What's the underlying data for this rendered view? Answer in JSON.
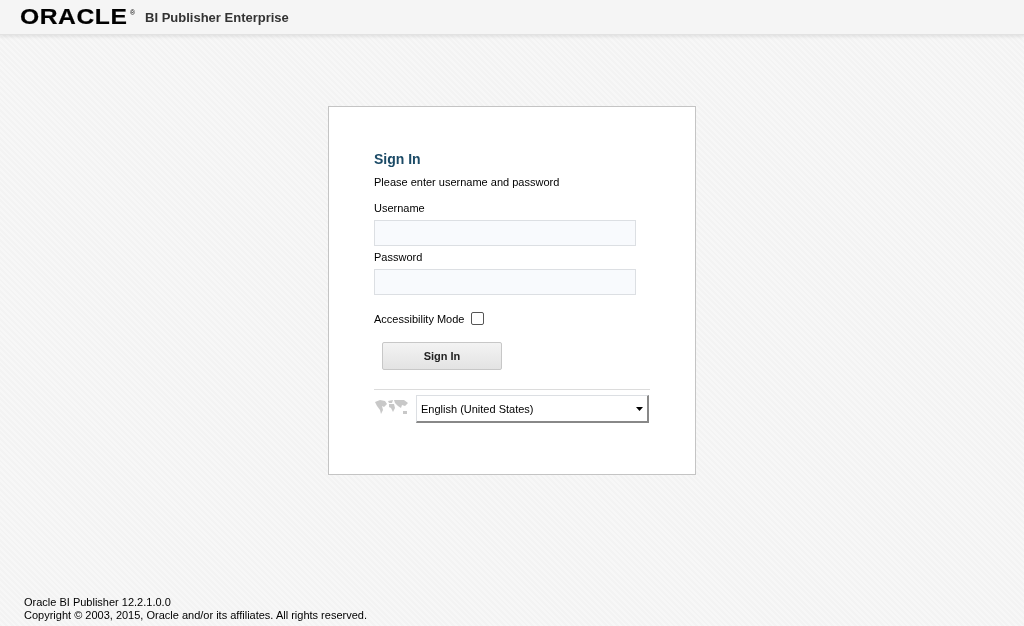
{
  "header": {
    "logo": "ORACLE",
    "logo_mark": "®",
    "product": "BI Publisher Enterprise"
  },
  "sign_in": {
    "title": "Sign In",
    "instruction": "Please enter username and password",
    "fields": [
      {
        "label": "Username"
      },
      {
        "label": "Password"
      }
    ],
    "accessibility": {
      "label": "Accessibility Mode",
      "checked": false
    },
    "button": "Sign In",
    "language": {
      "value": "English (United States)"
    }
  },
  "footer": {
    "version": "Oracle BI Publisher 12.2.1.0.0",
    "copyright": "Copyright © 2003, 2015, Oracle and/or its affiliates. All rights reserved."
  }
}
